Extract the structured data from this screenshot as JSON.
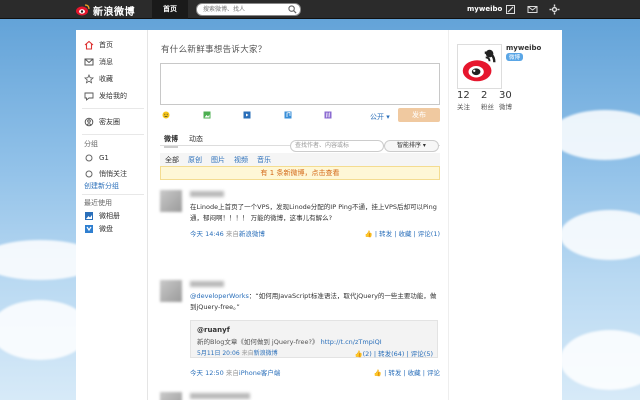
{
  "header": {
    "logo_text": "新浪微博",
    "nav_home": "首页",
    "search_placeholder": "搜索微博、找人",
    "username": "myweibo"
  },
  "leftnav": {
    "items": [
      {
        "label": "首页",
        "icon": "home-icon"
      },
      {
        "label": "消息",
        "icon": "mail-icon"
      },
      {
        "label": "收藏",
        "icon": "star-icon"
      },
      {
        "label": "发给我的",
        "icon": "comment-icon"
      },
      {
        "label": "密友圈",
        "icon": "friends-icon"
      }
    ],
    "group_title": "分组",
    "groups": [
      {
        "label": "G1"
      },
      {
        "label": "悄悄关注"
      }
    ],
    "create_group": "创建新分组",
    "recent_title": "最近使用",
    "recent": [
      {
        "label": "微相册"
      },
      {
        "label": "微盘"
      }
    ]
  },
  "compose": {
    "prompt": "有什么新鲜事想告诉大家？",
    "visibility": "公开",
    "post_button": "发布"
  },
  "feed_tabs": {
    "tabs": [
      "微博",
      "动态"
    ],
    "filter_placeholder": "查找作者、内容或标",
    "sort": "智能排序",
    "subtabs": [
      "全部",
      "原创",
      "图片",
      "视频",
      "音乐"
    ],
    "new_notice": "有 1 条新微博，点击查看"
  },
  "feed": [
    {
      "text": "在Linode上首页了一个VPS，发现Linode分配的IP Ping不通，挂上VPS后却可以Ping通，郁闷啊！！！！ 万能的微博，这事儿有解么?",
      "time": "今天 14:46",
      "source_prefix": "来自",
      "source": "新浪微博",
      "actions": {
        "forward": "转发",
        "fav": "收藏",
        "comment": "评论(1)"
      }
    },
    {
      "mention": "@developerWorks",
      "text": "：“如何用JavaScript标准语法，取代jQuery的一些主要功能，做到jQuery-free。”",
      "quote": {
        "name": "@ruanyf",
        "text": "新的Blog文章《如何做到 jQuery-free?》",
        "link": "http://t.cn/zTmpiQI",
        "time": "5月11日 20:06",
        "source_prefix": "来自",
        "source": "新浪微博",
        "likes": "(2)",
        "forward": "转发(64)",
        "comment": "评论(5)"
      },
      "time": "今天 12:50",
      "source_prefix": "来自",
      "source": "iPhone客户端",
      "actions": {
        "forward": "转发",
        "fav": "收藏",
        "comment": "评论"
      }
    }
  ],
  "profile": {
    "name": "myweibo",
    "badge": "微博",
    "stats": [
      {
        "num": "12",
        "label": "关注"
      },
      {
        "num": "2",
        "label": "粉丝"
      },
      {
        "num": "30",
        "label": "微博"
      }
    ]
  },
  "colors": {
    "link": "#2a6fba",
    "topbar": "#2b2b2b",
    "notice": "#d46a1a"
  }
}
